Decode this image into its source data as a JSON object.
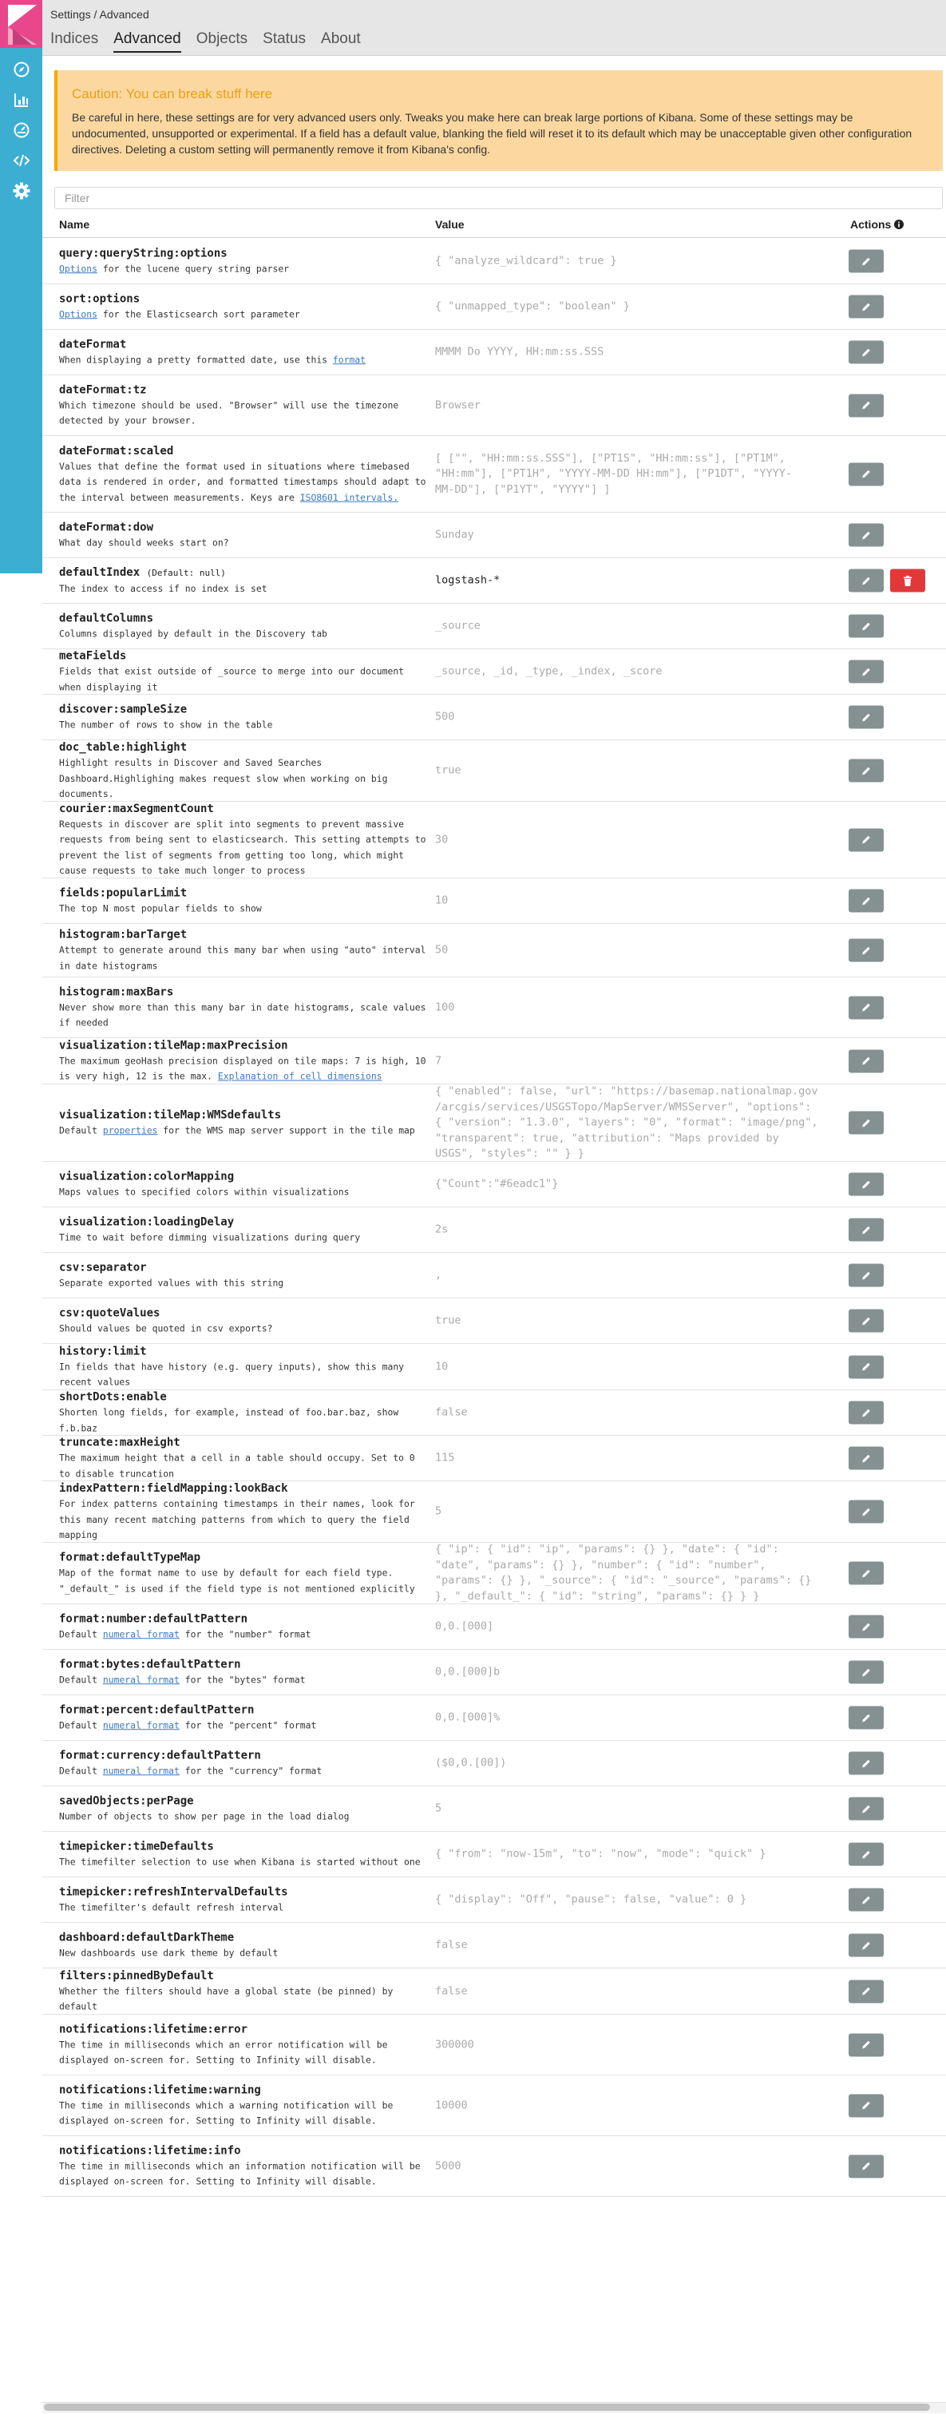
{
  "breadcrumb": "Settings / Advanced",
  "tabs": [
    "Indices",
    "Advanced",
    "Objects",
    "Status",
    "About"
  ],
  "sidebar_icons": [
    "compass-icon",
    "bar-chart-icon",
    "dashboard-icon",
    "code-icon",
    "gear-icon"
  ],
  "callout": {
    "title": "Caution: You can break stuff here",
    "text": "Be careful in here, these settings are for very advanced users only. Tweaks you make here can break large portions of Kibana. Some of these settings may be undocumented, unsupported or experimental. If a field has a default value, blanking the field will reset it to its default which may be unacceptable given other configuration directives. Deleting a custom setting will permanently remove it from Kibana's config."
  },
  "filter": {
    "placeholder": "Filter"
  },
  "columns": {
    "name": "Name",
    "value": "Value",
    "actions": "Actions"
  },
  "settings": [
    {
      "name": "query:queryString:options",
      "pre": "",
      "link": "Options",
      "post": " for the lucene query string parser",
      "value": "{ \"analyze_wildcard\": true }"
    },
    {
      "name": "sort:options",
      "pre": "",
      "link": "Options",
      "post": " for the Elasticsearch sort parameter",
      "value": "{ \"unmapped_type\": \"boolean\" }"
    },
    {
      "name": "dateFormat",
      "pre": "When displaying a pretty formatted date, use this ",
      "link": "format",
      "post": "",
      "value": "MMMM Do YYYY, HH:mm:ss.SSS"
    },
    {
      "name": "dateFormat:tz",
      "pre": "Which timezone should be used. \"Browser\" will use the timezone\ndetected by your browser.",
      "link": "",
      "post": "",
      "value": "Browser"
    },
    {
      "name": "dateFormat:scaled",
      "pre": "Values that define the format used in situations where timebased\ndata is rendered in order, and formatted timestamps should adapt to\nthe interval between measurements. Keys are ",
      "link": "ISO8601 intervals.",
      "post": "",
      "value": "[ [\"\", \"HH:mm:ss.SSS\"], [\"PT1S\", \"HH:mm:ss\"], [\"PT1M\",\n\"HH:mm\"], [\"PT1H\", \"YYYY-MM-DD HH:mm\"], [\"P1DT\", \"YYYY-\nMM-DD\"], [\"P1YT\", \"YYYY\"] ]"
    },
    {
      "name": "dateFormat:dow",
      "pre": "What day should weeks start on?",
      "link": "",
      "post": "",
      "value": "Sunday"
    },
    {
      "name": "defaultIndex",
      "def": "(Default: null)",
      "pre": "The index to access if no index is set",
      "link": "",
      "post": "",
      "value": "logstash-*",
      "active": true,
      "deletable": true
    },
    {
      "name": "defaultColumns",
      "pre": "Columns displayed by default in the Discovery tab",
      "link": "",
      "post": "",
      "value": "_source"
    },
    {
      "name": "metaFields",
      "pre": "Fields that exist outside of _source to merge into our document\nwhen displaying it",
      "link": "",
      "post": "",
      "value": "_source, _id, _type, _index, _score"
    },
    {
      "name": "discover:sampleSize",
      "pre": "The number of rows to show in the table",
      "link": "",
      "post": "",
      "value": "500"
    },
    {
      "name": "doc_table:highlight",
      "pre": "Highlight results in Discover and Saved Searches\nDashboard.Highlighing makes request slow when working on big\ndocuments.",
      "link": "",
      "post": "",
      "value": "true"
    },
    {
      "name": "courier:maxSegmentCount",
      "pre": "Requests in discover are split into segments to prevent massive\nrequests from being sent to elasticsearch. This setting attempts to\nprevent the list of segments from getting too long, which might\ncause requests to take much longer to process",
      "link": "",
      "post": "",
      "value": "30"
    },
    {
      "name": "fields:popularLimit",
      "pre": "The top N most popular fields to show",
      "link": "",
      "post": "",
      "value": "10"
    },
    {
      "name": "histogram:barTarget",
      "pre": "Attempt to generate around this many bar when using \"auto\" interval\nin date histograms",
      "link": "",
      "post": "",
      "value": "50"
    },
    {
      "name": "histogram:maxBars",
      "pre": "Never show more than this many bar in date histograms, scale values\nif needed",
      "link": "",
      "post": "",
      "value": "100"
    },
    {
      "name": "visualization:tileMap:maxPrecision",
      "pre": "The maximum geoHash precision displayed on tile maps: 7 is high, 10\nis very high, 12 is the max. ",
      "link": "Explanation of cell dimensions",
      "post": "",
      "value": "7"
    },
    {
      "name": "visualization:tileMap:WMSdefaults",
      "pre": "Default ",
      "link": "properties",
      "post": " for the WMS map server support in the tile map",
      "value": "{ \"enabled\": false, \"url\": \"https://basemap.nationalmap.gov\n/arcgis/services/USGSTopo/MapServer/WMSServer\", \"options\":\n{ \"version\": \"1.3.0\", \"layers\": \"0\", \"format\": \"image/png\",\n\"transparent\": true, \"attribution\": \"Maps provided by\nUSGS\", \"styles\": \"\" } }"
    },
    {
      "name": "visualization:colorMapping",
      "pre": "Maps values to specified colors within visualizations",
      "link": "",
      "post": "",
      "value": "{\"Count\":\"#6eadc1\"}"
    },
    {
      "name": "visualization:loadingDelay",
      "pre": "Time to wait before dimming visualizations during query",
      "link": "",
      "post": "",
      "value": "2s"
    },
    {
      "name": "csv:separator",
      "pre": "Separate exported values with this string",
      "link": "",
      "post": "",
      "value": ","
    },
    {
      "name": "csv:quoteValues",
      "pre": "Should values be quoted in csv exports?",
      "link": "",
      "post": "",
      "value": "true"
    },
    {
      "name": "history:limit",
      "pre": "In fields that have history (e.g. query inputs), show this many\nrecent values",
      "link": "",
      "post": "",
      "value": "10"
    },
    {
      "name": "shortDots:enable",
      "pre": "Shorten long fields, for example, instead of foo.bar.baz, show\nf.b.baz",
      "link": "",
      "post": "",
      "value": "false"
    },
    {
      "name": "truncate:maxHeight",
      "pre": "The maximum height that a cell in a table should occupy. Set to 0\nto disable truncation",
      "link": "",
      "post": "",
      "value": "115"
    },
    {
      "name": "indexPattern:fieldMapping:lookBack",
      "pre": "For index patterns containing timestamps in their names, look for\nthis many recent matching patterns from which to query the field\nmapping",
      "link": "",
      "post": "",
      "value": "5"
    },
    {
      "name": "format:defaultTypeMap",
      "pre": "Map of the format name to use by default for each field type.\n\"_default_\" is used if the field type is not mentioned explicitly",
      "link": "",
      "post": "",
      "value": "{ \"ip\": { \"id\": \"ip\", \"params\": {} }, \"date\": { \"id\":\n\"date\", \"params\": {} }, \"number\": { \"id\": \"number\",\n\"params\": {} }, \"_source\": { \"id\": \"_source\", \"params\": {}\n}, \"_default_\": { \"id\": \"string\", \"params\": {} } }"
    },
    {
      "name": "format:number:defaultPattern",
      "pre": "Default ",
      "link": "numeral format",
      "post": " for the \"number\" format",
      "value": "0,0.[000]"
    },
    {
      "name": "format:bytes:defaultPattern",
      "pre": "Default ",
      "link": "numeral format",
      "post": " for the \"bytes\" format",
      "value": "0,0.[000]b"
    },
    {
      "name": "format:percent:defaultPattern",
      "pre": "Default ",
      "link": "numeral format",
      "post": " for the \"percent\" format",
      "value": "0,0.[000]%"
    },
    {
      "name": "format:currency:defaultPattern",
      "pre": "Default ",
      "link": "numeral format",
      "post": " for the \"currency\" format",
      "value": "($0,0.[00])"
    },
    {
      "name": "savedObjects:perPage",
      "pre": "Number of objects to show per page in the load dialog",
      "link": "",
      "post": "",
      "value": "5"
    },
    {
      "name": "timepicker:timeDefaults",
      "pre": "The timefilter selection to use when Kibana is started without one",
      "link": "",
      "post": "",
      "value": "{ \"from\": \"now-15m\", \"to\": \"now\", \"mode\": \"quick\" }"
    },
    {
      "name": "timepicker:refreshIntervalDefaults",
      "pre": "The timefilter's default refresh interval",
      "link": "",
      "post": "",
      "value": "{ \"display\": \"Off\", \"pause\": false, \"value\": 0 }"
    },
    {
      "name": "dashboard:defaultDarkTheme",
      "pre": "New dashboards use dark theme by default",
      "link": "",
      "post": "",
      "value": "false"
    },
    {
      "name": "filters:pinnedByDefault",
      "pre": "Whether the filters should have a global state (be pinned) by\ndefault",
      "link": "",
      "post": "",
      "value": "false"
    },
    {
      "name": "notifications:lifetime:error",
      "pre": "The time in milliseconds which an error notification will be\ndisplayed on-screen for. Setting to Infinity will disable.",
      "link": "",
      "post": "",
      "value": "300000"
    },
    {
      "name": "notifications:lifetime:warning",
      "pre": "The time in milliseconds which a warning notification will be\ndisplayed on-screen for. Setting to Infinity will disable.",
      "link": "",
      "post": "",
      "value": "10000"
    },
    {
      "name": "notifications:lifetime:info",
      "pre": "The time in milliseconds which an information notification will be\ndisplayed on-screen for. Setting to Infinity will disable.",
      "link": "",
      "post": "",
      "value": "5000"
    }
  ]
}
